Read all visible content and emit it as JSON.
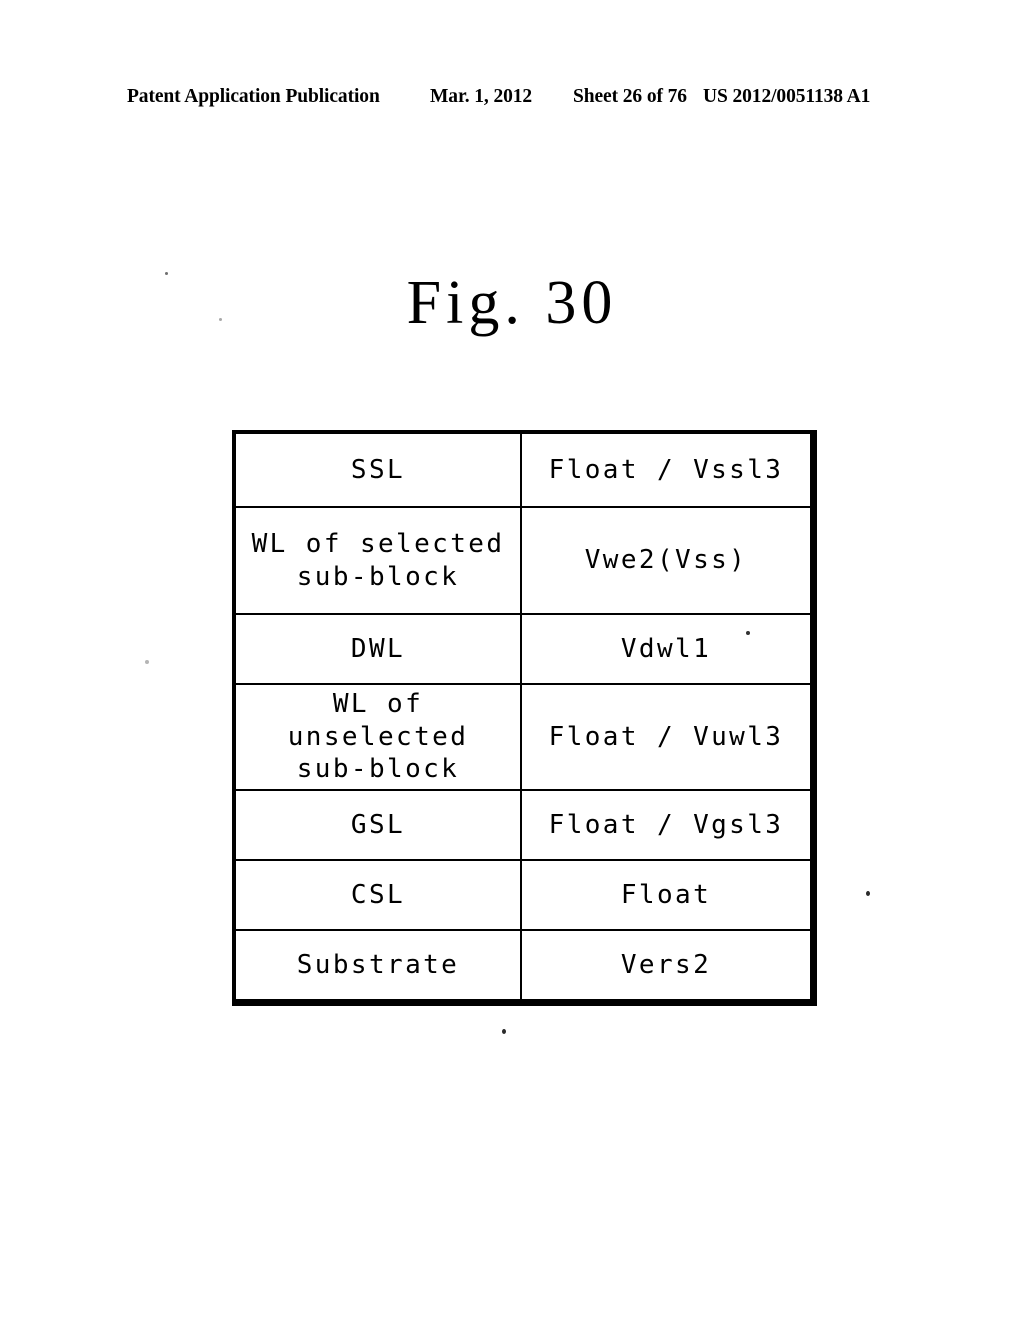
{
  "header": {
    "publication": "Patent Application Publication",
    "date": "Mar. 1, 2012",
    "sheet": "Sheet 26 of 76",
    "patent_number": "US 2012/0051138 A1"
  },
  "figure": {
    "title": "Fig. 30"
  },
  "table": {
    "rows": [
      {
        "label_line1": "SSL",
        "label_line2": "",
        "value": "Float / Vssl3"
      },
      {
        "label_line1": "WL of selected",
        "label_line2": "sub-block",
        "value": "Vwe2(Vss)"
      },
      {
        "label_line1": "DWL",
        "label_line2": "",
        "value": "Vdwl1"
      },
      {
        "label_line1": "WL of unselected",
        "label_line2": "sub-block",
        "value": "Float / Vuwl3"
      },
      {
        "label_line1": "GSL",
        "label_line2": "",
        "value": "Float / Vgsl3"
      },
      {
        "label_line1": "CSL",
        "label_line2": "",
        "value": "Float"
      },
      {
        "label_line1": "Substrate",
        "label_line2": "",
        "value": "Vers2"
      }
    ]
  },
  "colors": {
    "ink": "#000000",
    "paper": "#ffffff"
  }
}
